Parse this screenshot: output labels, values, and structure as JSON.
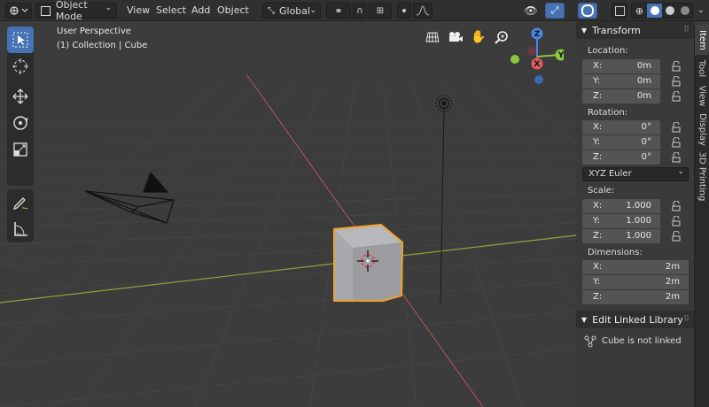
{
  "header": {
    "mode_label": "Object Mode",
    "menus": [
      "View",
      "Select",
      "Add",
      "Object"
    ],
    "orientation_label": "Global"
  },
  "viewport": {
    "view_name": "User Perspective",
    "collection_info": "(1) Collection | Cube",
    "gizmo": {
      "x": "X",
      "y": "Y",
      "z": "Z"
    }
  },
  "npanel": {
    "tabs": [
      "Item",
      "Tool",
      "View",
      "Display",
      "3D Printing"
    ],
    "active_tab": "Item",
    "transform": {
      "title": "Transform",
      "location_label": "Location:",
      "location": [
        {
          "axis": "X:",
          "value": "0m"
        },
        {
          "axis": "Y:",
          "value": "0m"
        },
        {
          "axis": "Z:",
          "value": "0m"
        }
      ],
      "rotation_label": "Rotation:",
      "rotation": [
        {
          "axis": "X:",
          "value": "0°"
        },
        {
          "axis": "Y:",
          "value": "0°"
        },
        {
          "axis": "Z:",
          "value": "0°"
        }
      ],
      "rotation_mode": "XYZ Euler",
      "scale_label": "Scale:",
      "scale": [
        {
          "axis": "X:",
          "value": "1.000"
        },
        {
          "axis": "Y:",
          "value": "1.000"
        },
        {
          "axis": "Z:",
          "value": "1.000"
        }
      ],
      "dimensions_label": "Dimensions:",
      "dimensions": [
        {
          "axis": "X:",
          "value": "2m"
        },
        {
          "axis": "Y:",
          "value": "2m"
        },
        {
          "axis": "Z:",
          "value": "2m"
        }
      ]
    },
    "linked_library": {
      "title": "Edit Linked Library",
      "status": "Cube is not linked"
    }
  },
  "colors": {
    "accent": "#4772b3",
    "selection_outline": "#f0a030",
    "x_axis": "#e05b5b",
    "y_axis": "#8cc63f",
    "z_axis": "#4a86e8"
  }
}
